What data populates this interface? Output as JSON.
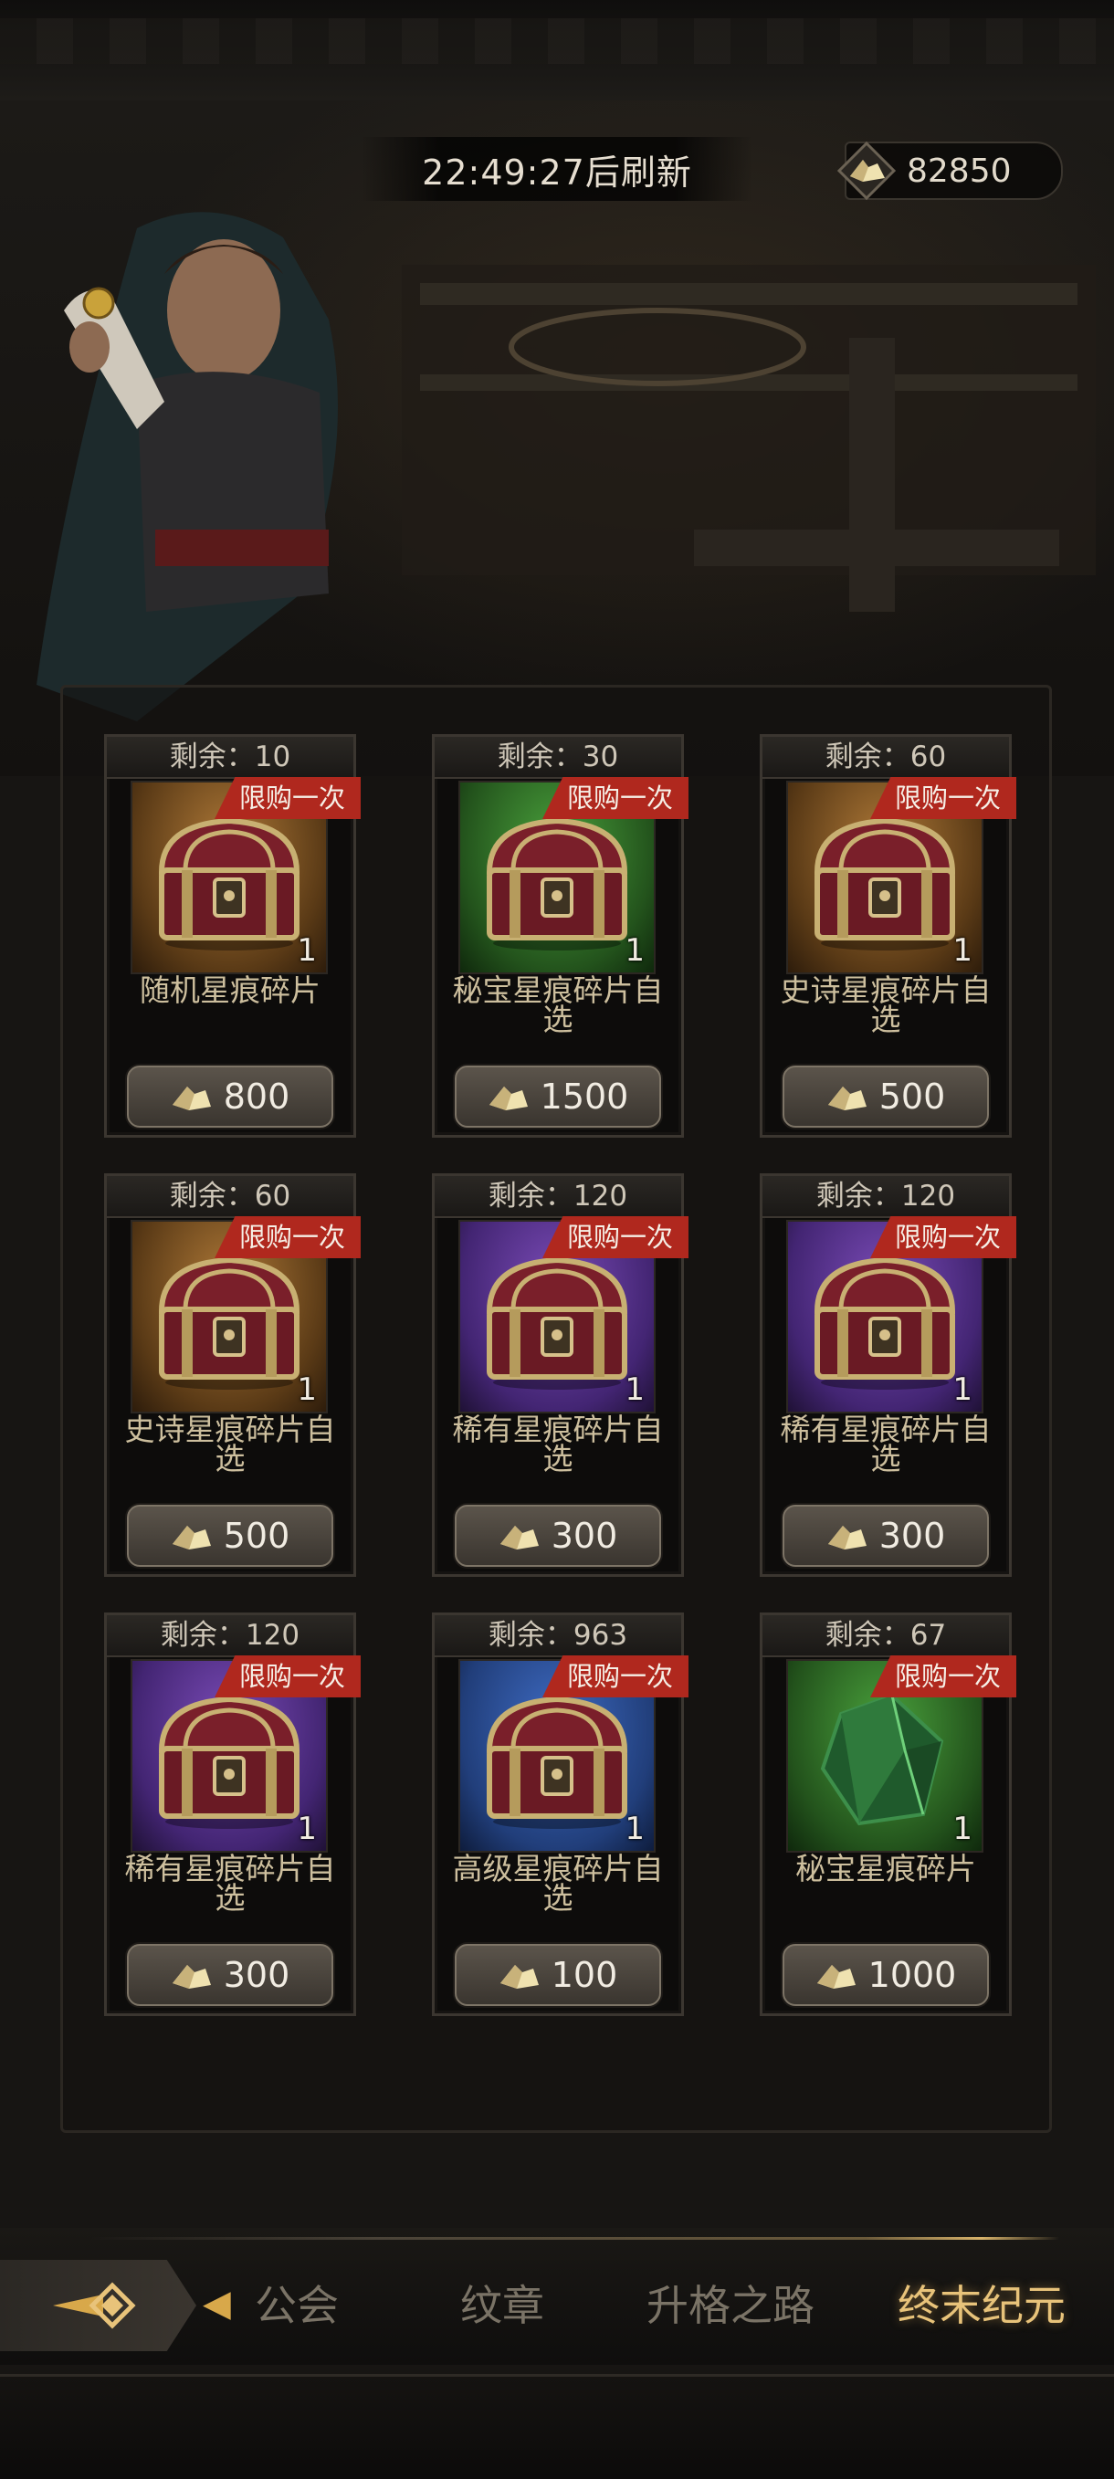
{
  "header": {
    "refresh_text": "22:49:27后刷新",
    "currency_value": "82850"
  },
  "shop_items": [
    {
      "remain": "剩余：10",
      "tag": "限购一次",
      "qty": "1",
      "name": "随机星痕碎片",
      "price": "800",
      "rarity": "orange",
      "icon": "chest-icon"
    },
    {
      "remain": "剩余：30",
      "tag": "限购一次",
      "qty": "1",
      "name": "秘宝星痕碎片自选",
      "price": "1500",
      "rarity": "green",
      "icon": "chest-icon"
    },
    {
      "remain": "剩余：60",
      "tag": "限购一次",
      "qty": "1",
      "name": "史诗星痕碎片自选",
      "price": "500",
      "rarity": "orange",
      "icon": "chest-icon"
    },
    {
      "remain": "剩余：60",
      "tag": "限购一次",
      "qty": "1",
      "name": "史诗星痕碎片自选",
      "price": "500",
      "rarity": "orange",
      "icon": "chest-icon"
    },
    {
      "remain": "剩余：120",
      "tag": "限购一次",
      "qty": "1",
      "name": "稀有星痕碎片自选",
      "price": "300",
      "rarity": "purple",
      "icon": "chest-icon"
    },
    {
      "remain": "剩余：120",
      "tag": "限购一次",
      "qty": "1",
      "name": "稀有星痕碎片自选",
      "price": "300",
      "rarity": "purple",
      "icon": "chest-icon"
    },
    {
      "remain": "剩余：120",
      "tag": "限购一次",
      "qty": "1",
      "name": "稀有星痕碎片自选",
      "price": "300",
      "rarity": "purple",
      "icon": "chest-icon"
    },
    {
      "remain": "剩余：963",
      "tag": "限购一次",
      "qty": "1",
      "name": "高级星痕碎片自选",
      "price": "100",
      "rarity": "blue",
      "icon": "chest-icon"
    },
    {
      "remain": "剩余：67",
      "tag": "限购一次",
      "qty": "1",
      "name": "秘宝星痕碎片",
      "price": "1000",
      "rarity": "green",
      "icon": "green-crystal-icon"
    }
  ],
  "bottom_nav": {
    "tabs": [
      {
        "label": "公会"
      },
      {
        "label": "纹章"
      },
      {
        "label": "升格之路"
      },
      {
        "label": "终末纪元",
        "active": true
      }
    ]
  },
  "colors": {
    "limit_tag": "#b0281e",
    "active_tab": "#e8c37a",
    "rarity_orange": "#b07a38",
    "rarity_green": "#4aa23c",
    "rarity_purple": "#7b4cb8",
    "rarity_blue": "#3f6cc4"
  }
}
